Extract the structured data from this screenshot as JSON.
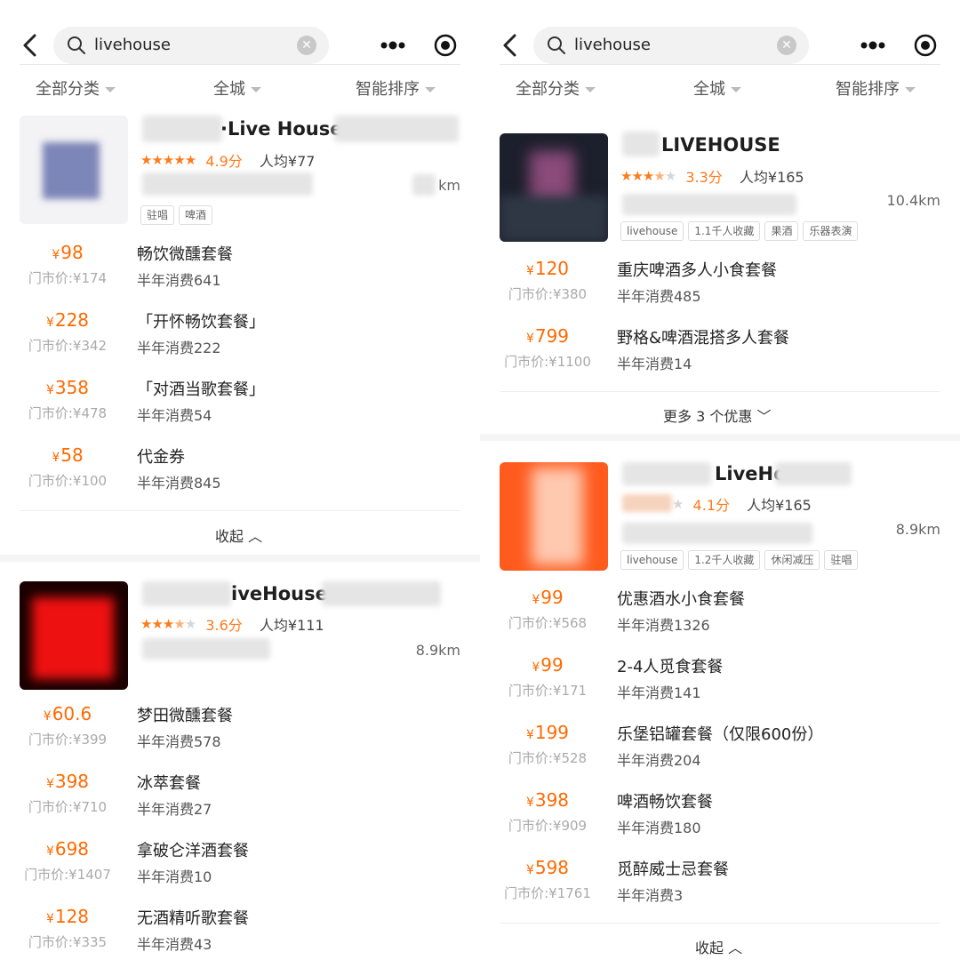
{
  "left": {
    "search": {
      "query": "livehouse"
    },
    "filters": {
      "category": "全部分类",
      "area": "全城",
      "sort": "智能排序"
    },
    "shop1": {
      "name_visible": "·Live House",
      "stars": "★★★★★",
      "score": "4.9分",
      "avg_price": "人均¥77",
      "distance": "km",
      "tags": [
        "驻唱",
        "啤酒"
      ],
      "deals": [
        {
          "price": "98",
          "orig": "门市价:¥174",
          "title": "畅饮微醺套餐",
          "sold": "半年消费641"
        },
        {
          "price": "228",
          "orig": "门市价:¥342",
          "title": "「开怀畅饮套餐」",
          "sold": "半年消费222"
        },
        {
          "price": "358",
          "orig": "门市价:¥478",
          "title": "「对酒当歌套餐」",
          "sold": "半年消费54"
        },
        {
          "price": "58",
          "orig": "门市价:¥100",
          "title": "代金券",
          "sold": "半年消费845"
        }
      ],
      "collapse": "收起"
    },
    "shop2": {
      "name_visible": "iveHouse",
      "stars_on": "★★★",
      "stars_half": "★",
      "stars_off": "★",
      "score": "3.6分",
      "avg_price": "人均¥111",
      "distance": "8.9km",
      "deals": [
        {
          "price": "60.6",
          "orig": "门市价:¥399",
          "title": "梦田微醺套餐",
          "sold": "半年消费578"
        },
        {
          "price": "398",
          "orig": "门市价:¥710",
          "title": "冰萃套餐",
          "sold": "半年消费27"
        },
        {
          "price": "698",
          "orig": "门市价:¥1407",
          "title": "拿破仑洋酒套餐",
          "sold": "半年消费10"
        },
        {
          "price": "128",
          "orig": "门市价:¥335",
          "title": "无酒精听歌套餐",
          "sold": "半年消费43"
        }
      ]
    }
  },
  "right": {
    "search": {
      "query": "livehouse"
    },
    "filters": {
      "category": "全部分类",
      "area": "全城",
      "sort": "智能排序"
    },
    "shop1": {
      "name_visible": "LIVEHOUSE",
      "stars_on": "★★★",
      "stars_half": "★",
      "stars_off": "★",
      "score": "3.3分",
      "avg_price": "人均¥165",
      "distance": "10.4km",
      "tags": [
        "livehouse",
        "1.1千人收藏",
        "果酒",
        "乐器表演"
      ],
      "deals": [
        {
          "price": "120",
          "orig": "门市价:¥380",
          "title": "重庆啤酒多人小食套餐",
          "sold": "半年消费485"
        },
        {
          "price": "799",
          "orig": "门市价:¥1100",
          "title": "野格&啤酒混搭多人套餐",
          "sold": "半年消费14"
        }
      ],
      "more": "更多 3 个优惠"
    },
    "shop2": {
      "name_visible": "LiveHouse",
      "stars_off": "★",
      "score": "4.1分",
      "avg_price": "人均¥165",
      "distance": "8.9km",
      "tags": [
        "livehouse",
        "1.2千人收藏",
        "休闲减压",
        "驻唱"
      ],
      "deals": [
        {
          "price": "99",
          "orig": "门市价:¥568",
          "title": "优惠酒水小食套餐",
          "sold": "半年消费1326"
        },
        {
          "price": "99",
          "orig": "门市价:¥171",
          "title": "2-4人觅食套餐",
          "sold": "半年消费141"
        },
        {
          "price": "199",
          "orig": "门市价:¥528",
          "title": "乐堡铝罐套餐（仅限600份）",
          "sold": "半年消费204"
        },
        {
          "price": "398",
          "orig": "门市价:¥909",
          "title": "啤酒畅饮套餐",
          "sold": "半年消费180"
        },
        {
          "price": "598",
          "orig": "门市价:¥1761",
          "title": "觅醉威士忌套餐",
          "sold": "半年消费3"
        }
      ],
      "collapse": "收起"
    }
  },
  "yen": "¥",
  "colors": {
    "accent": "#ff6a00",
    "star": "#ff7a1a"
  }
}
